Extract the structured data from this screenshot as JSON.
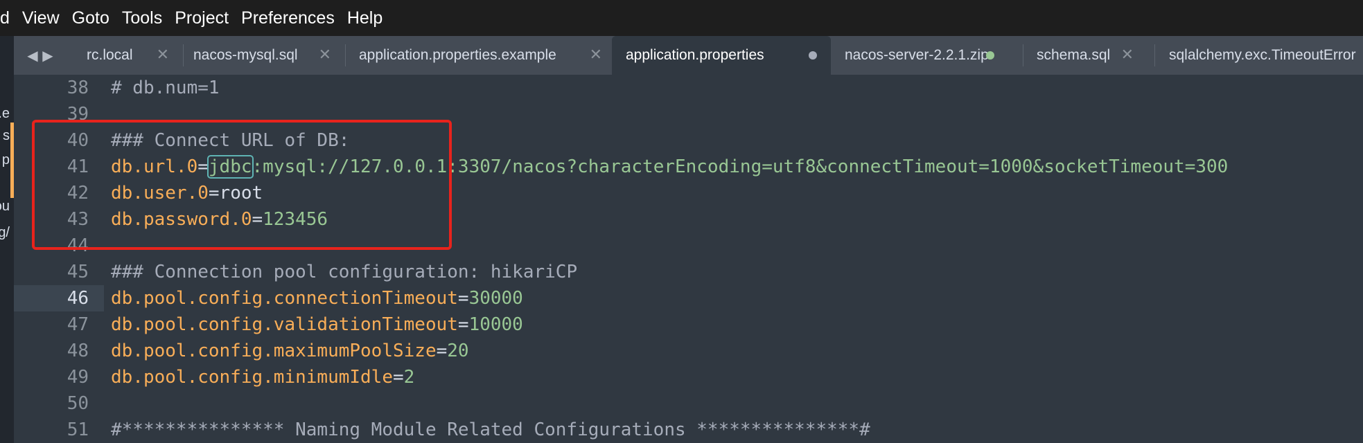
{
  "menu": [
    "d",
    "View",
    "Goto",
    "Tools",
    "Project",
    "Preferences",
    "Help"
  ],
  "sidebar": {
    "items": [
      {
        "label": "s.e",
        "modified": true
      },
      {
        "label": "s",
        "modified": true
      },
      {
        "label": "p",
        "modified": true
      },
      {
        "label": "",
        "modified": false
      },
      {
        "label": "ou",
        "modified": false
      },
      {
        "label": "g/",
        "modified": false
      }
    ]
  },
  "tabbar": {
    "back_icon": "◀",
    "forward_icon": "▶",
    "tabs": [
      {
        "label": "rc.local",
        "state": "close"
      },
      {
        "label": "nacos-mysql.sql",
        "state": "close"
      },
      {
        "label": "application.properties.example",
        "state": "close"
      },
      {
        "label": "application.properties",
        "state": "modified",
        "active": true
      },
      {
        "label": "nacos-server-2.2.1.zip",
        "state": "green-dot"
      },
      {
        "label": "schema.sql",
        "state": "close"
      },
      {
        "label": "sqlalchemy.exc.TimeoutError",
        "state": "none"
      }
    ],
    "close_glyph": "✕"
  },
  "editor": {
    "current_line": 46,
    "lines": [
      {
        "n": "38",
        "comment": "# db.num=1"
      },
      {
        "n": "39"
      },
      {
        "n": "40",
        "comment": "### Connect URL of DB:"
      },
      {
        "n": "41",
        "key": "db.url.0",
        "op": "=",
        "val_hl": "jdbc",
        "val": ":mysql://127.0.0.1:3307/nacos?characterEncoding=utf8&connectTimeout=1000&socketTimeout=300"
      },
      {
        "n": "42",
        "key": "db.user.0",
        "op": "=",
        "plain": "root"
      },
      {
        "n": "43",
        "key": "db.password.0",
        "op": "=",
        "val": "123456"
      },
      {
        "n": "44"
      },
      {
        "n": "45",
        "comment": "### Connection pool configuration: hikariCP"
      },
      {
        "n": "46",
        "key": "db.pool.config.connectionTimeout",
        "op": "=",
        "val": "30000"
      },
      {
        "n": "47",
        "key": "db.pool.config.validationTimeout",
        "op": "=",
        "val": "10000"
      },
      {
        "n": "48",
        "key": "db.pool.config.maximumPoolSize",
        "op": "=",
        "val": "20"
      },
      {
        "n": "49",
        "key": "db.pool.config.minimumIdle",
        "op": "=",
        "val": "2"
      },
      {
        "n": "50"
      },
      {
        "n": "51",
        "comment": "#*************** Naming Module Related Configurations ***************#"
      }
    ]
  },
  "colors": {
    "annotation_box": "#e8231c",
    "modified_marker": "#f9ae58",
    "green_dot": "#99c794",
    "modified_dot": "#a6acb9"
  }
}
